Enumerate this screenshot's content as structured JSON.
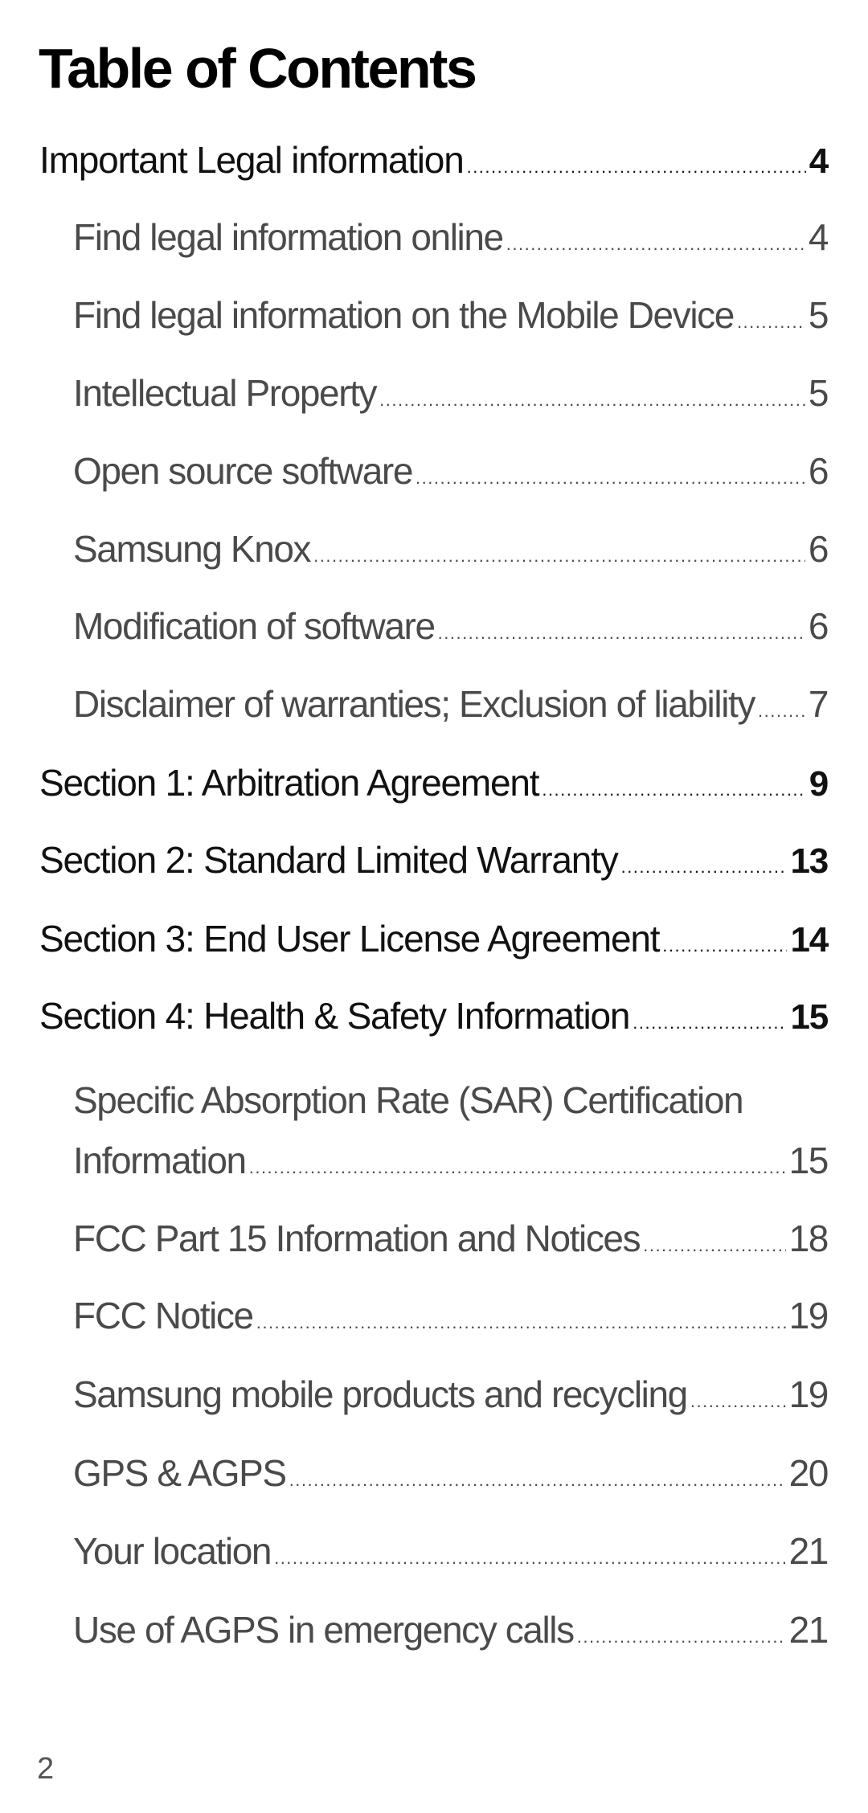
{
  "document": {
    "title": "Table of Contents",
    "page_number": "2"
  },
  "toc": {
    "entries": [
      {
        "label": "Important Legal information",
        "page": "4",
        "level": 1
      },
      {
        "label": "Find legal information online",
        "page": "4",
        "level": 2
      },
      {
        "label": "Find legal information on the Mobile Device",
        "page": "5",
        "level": 2
      },
      {
        "label": "Intellectual Property",
        "page": "5",
        "level": 2
      },
      {
        "label": "Open source software",
        "page": "6",
        "level": 2
      },
      {
        "label": "Samsung Knox",
        "page": "6",
        "level": 2
      },
      {
        "label": "Modification of software",
        "page": "6",
        "level": 2
      },
      {
        "label": "Disclaimer of warranties; Exclusion of liability",
        "page": "7",
        "level": 2
      },
      {
        "label": "Section 1: Arbitration Agreement",
        "page": "9",
        "level": 1
      },
      {
        "label": "Section 2: Standard Limited Warranty",
        "page": "13",
        "level": 1
      },
      {
        "label": "Section 3: End User License Agreement",
        "page": "14",
        "level": 1
      },
      {
        "label": "Section 4: Health & Safety Information",
        "page": "15",
        "level": 1
      },
      {
        "label_line1": "Specific Absorption Rate (SAR) Certification",
        "label": "Information",
        "page": "15",
        "level": 2
      },
      {
        "label": "FCC Part 15 Information and Notices",
        "page": "18",
        "level": 2
      },
      {
        "label": "FCC Notice",
        "page": "19",
        "level": 2
      },
      {
        "label": "Samsung mobile products and recycling",
        "page": "19",
        "level": 2
      },
      {
        "label": "GPS & AGPS",
        "page": "20",
        "level": 2
      },
      {
        "label": "Your location",
        "page": "21",
        "level": 2
      },
      {
        "label": "Use of AGPS in emergency calls",
        "page": "21",
        "level": 2
      }
    ]
  }
}
